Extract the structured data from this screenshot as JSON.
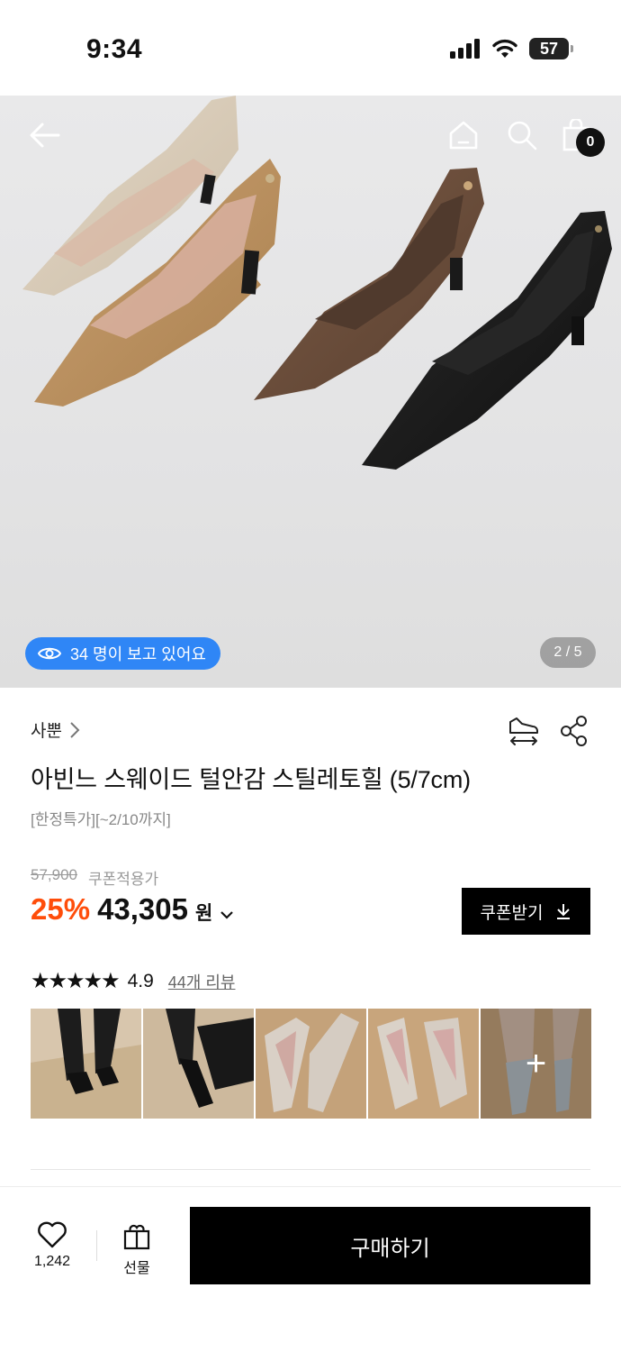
{
  "status_bar": {
    "time": "9:34",
    "battery": "57"
  },
  "hero": {
    "cart_count": "0",
    "viewers_text": "34 명이 보고 있어요",
    "page_indicator": "2 / 5"
  },
  "product": {
    "brand": "사뿐",
    "title": "아빈느 스웨이드 털안감 스틸레토힐 (5/7cm)",
    "subtitle": "[한정특가][~2/10까지]",
    "original_price": "57,900",
    "coupon_price_label": "쿠폰적용가",
    "discount": "25%",
    "sale_price": "43,305",
    "currency": "원",
    "coupon_button": "쿠폰받기"
  },
  "reviews": {
    "stars": "★★★★★",
    "rating": "4.9",
    "count_label": "44개 리뷰",
    "thumbnails": [
      {
        "name": "review-photo-1"
      },
      {
        "name": "review-photo-2"
      },
      {
        "name": "review-photo-3"
      },
      {
        "name": "review-photo-4"
      },
      {
        "name": "review-photo-5",
        "more": "+"
      }
    ]
  },
  "bottom_bar": {
    "like_count": "1,242",
    "gift_label": "선물",
    "buy_label": "구매하기"
  },
  "colors": {
    "accent_blue": "#2f86f6",
    "discount_orange": "#ff4d0a",
    "primary_black": "#000000"
  }
}
